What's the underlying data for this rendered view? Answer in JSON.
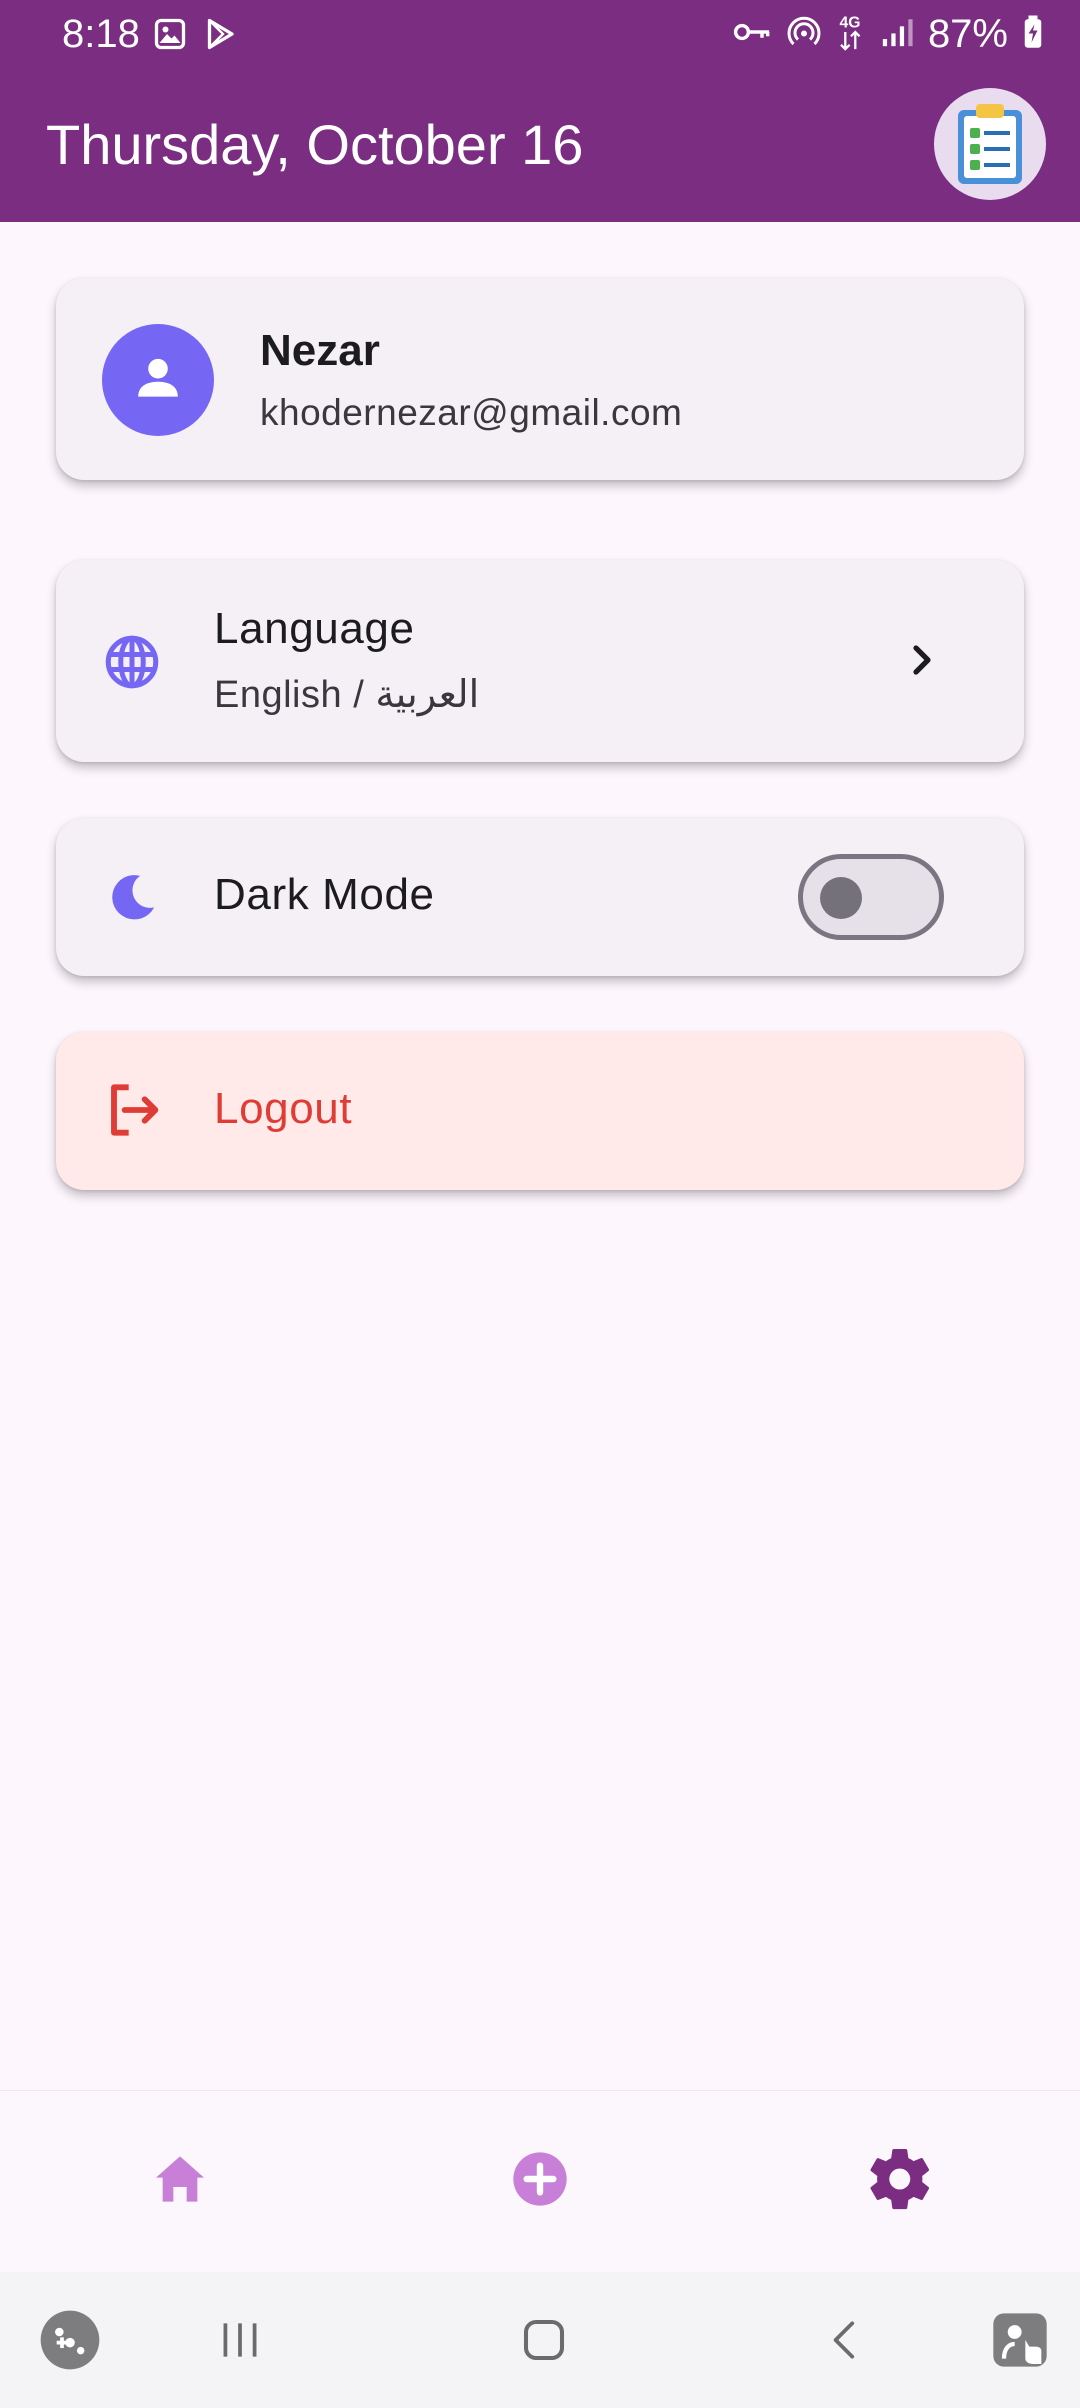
{
  "status_bar": {
    "time": "8:18",
    "battery": "87%",
    "network": "4G",
    "left_icons": [
      "image-icon",
      "play-store-icon"
    ],
    "right_icons": [
      "key-icon",
      "hotspot-icon",
      "network-4g-icon",
      "signal-icon",
      "battery-charging-icon"
    ]
  },
  "header": {
    "date": "Thursday, October 16",
    "logo_icon": "clipboard-checklist-icon",
    "background_color": "#7b2d82"
  },
  "profile": {
    "name": "Nezar",
    "email": "khodernezar@gmail.com",
    "avatar_icon": "person-icon",
    "avatar_color": "#7666f4"
  },
  "settings": {
    "language": {
      "title": "Language",
      "subtitle": "English / العربية",
      "icon": "globe-icon"
    },
    "dark_mode": {
      "label": "Dark Mode",
      "icon": "moon-icon",
      "enabled": false
    },
    "logout": {
      "label": "Logout",
      "icon": "logout-icon",
      "color": "#df3c36"
    }
  },
  "bottom_nav": {
    "items": [
      {
        "name": "home",
        "icon": "home-icon",
        "active": false
      },
      {
        "name": "add",
        "icon": "add-circle-icon",
        "active": false
      },
      {
        "name": "settings",
        "icon": "gear-icon",
        "active": true
      }
    ],
    "inactive_color": "#c77fd8",
    "active_color": "#7b2d82"
  },
  "system_nav": {
    "items": [
      "game-launcher-icon",
      "recents-icon",
      "home-icon",
      "back-icon",
      "accessibility-icon"
    ]
  }
}
